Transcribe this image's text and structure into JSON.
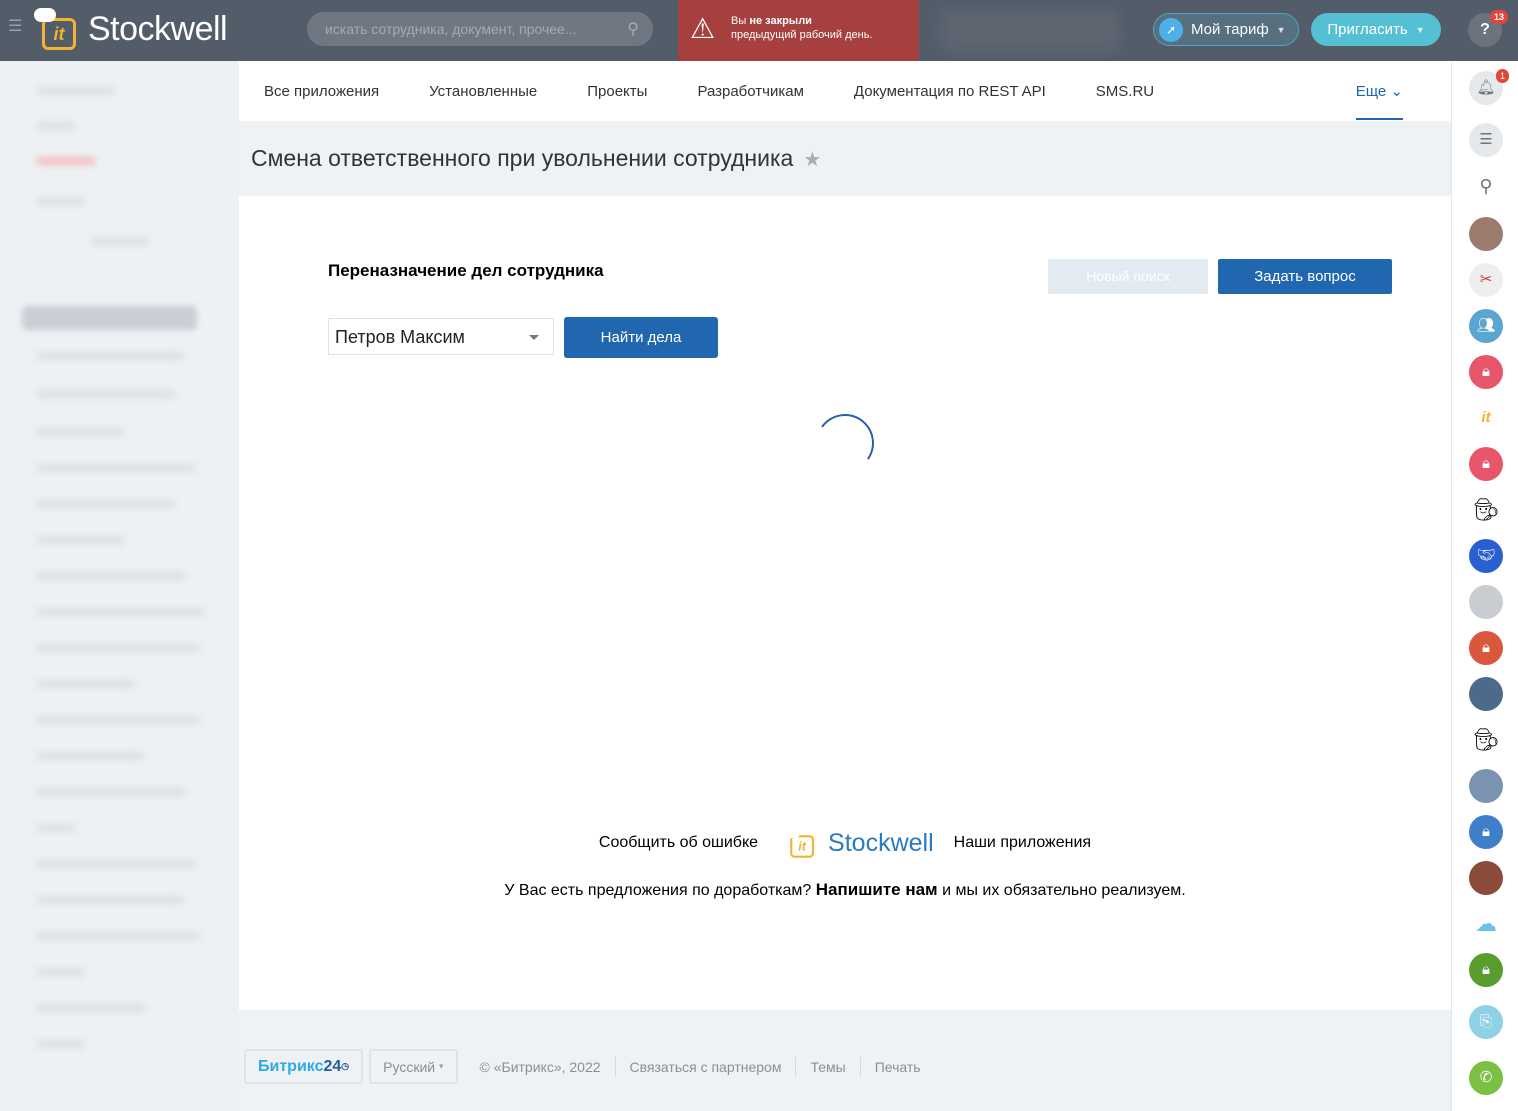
{
  "header": {
    "brand": "Stockwell",
    "search_placeholder": "искать сотрудника, документ, прочее...",
    "alert_line1_pre": "Вы ",
    "alert_line1_bold": "не закрыли",
    "alert_line2": "предыдущий рабочий день.",
    "tariff": "Мой тариф",
    "invite": "Пригласить",
    "help_badge": "13"
  },
  "tabs": [
    "Все приложения",
    "Установленные",
    "Проекты",
    "Разработчикам",
    "Документация по REST API",
    "SMS.RU"
  ],
  "tab_more": "Еще",
  "page_title": "Смена ответственного при увольнении сотрудника",
  "card": {
    "heading": "Переназначение дел сотрудника",
    "new_search": "Новый поиск",
    "ask": "Задать вопрос",
    "employee": "Петров Максим",
    "find": "Найти дела"
  },
  "footer": {
    "report": "Сообщить об ошибке",
    "brand": "Stockwell",
    "our_apps": "Наши приложения",
    "suggest_pre": "У Вас есть предложения по доработкам?",
    "suggest_bold": "Напишите нам",
    "suggest_post": "и мы их обязательно реализуем."
  },
  "bottom": {
    "b24_a": "Битрикс",
    "b24_b": "24",
    "lang": "Русский",
    "copyright": "© «Битрикс», 2022",
    "partner": "Связаться с партнером",
    "themes": "Темы",
    "print": "Печать"
  },
  "right": {
    "notif_badge": "1"
  },
  "colors": {
    "header": "#535c69",
    "accent": "#2067b0",
    "alert": "#a5403f"
  }
}
